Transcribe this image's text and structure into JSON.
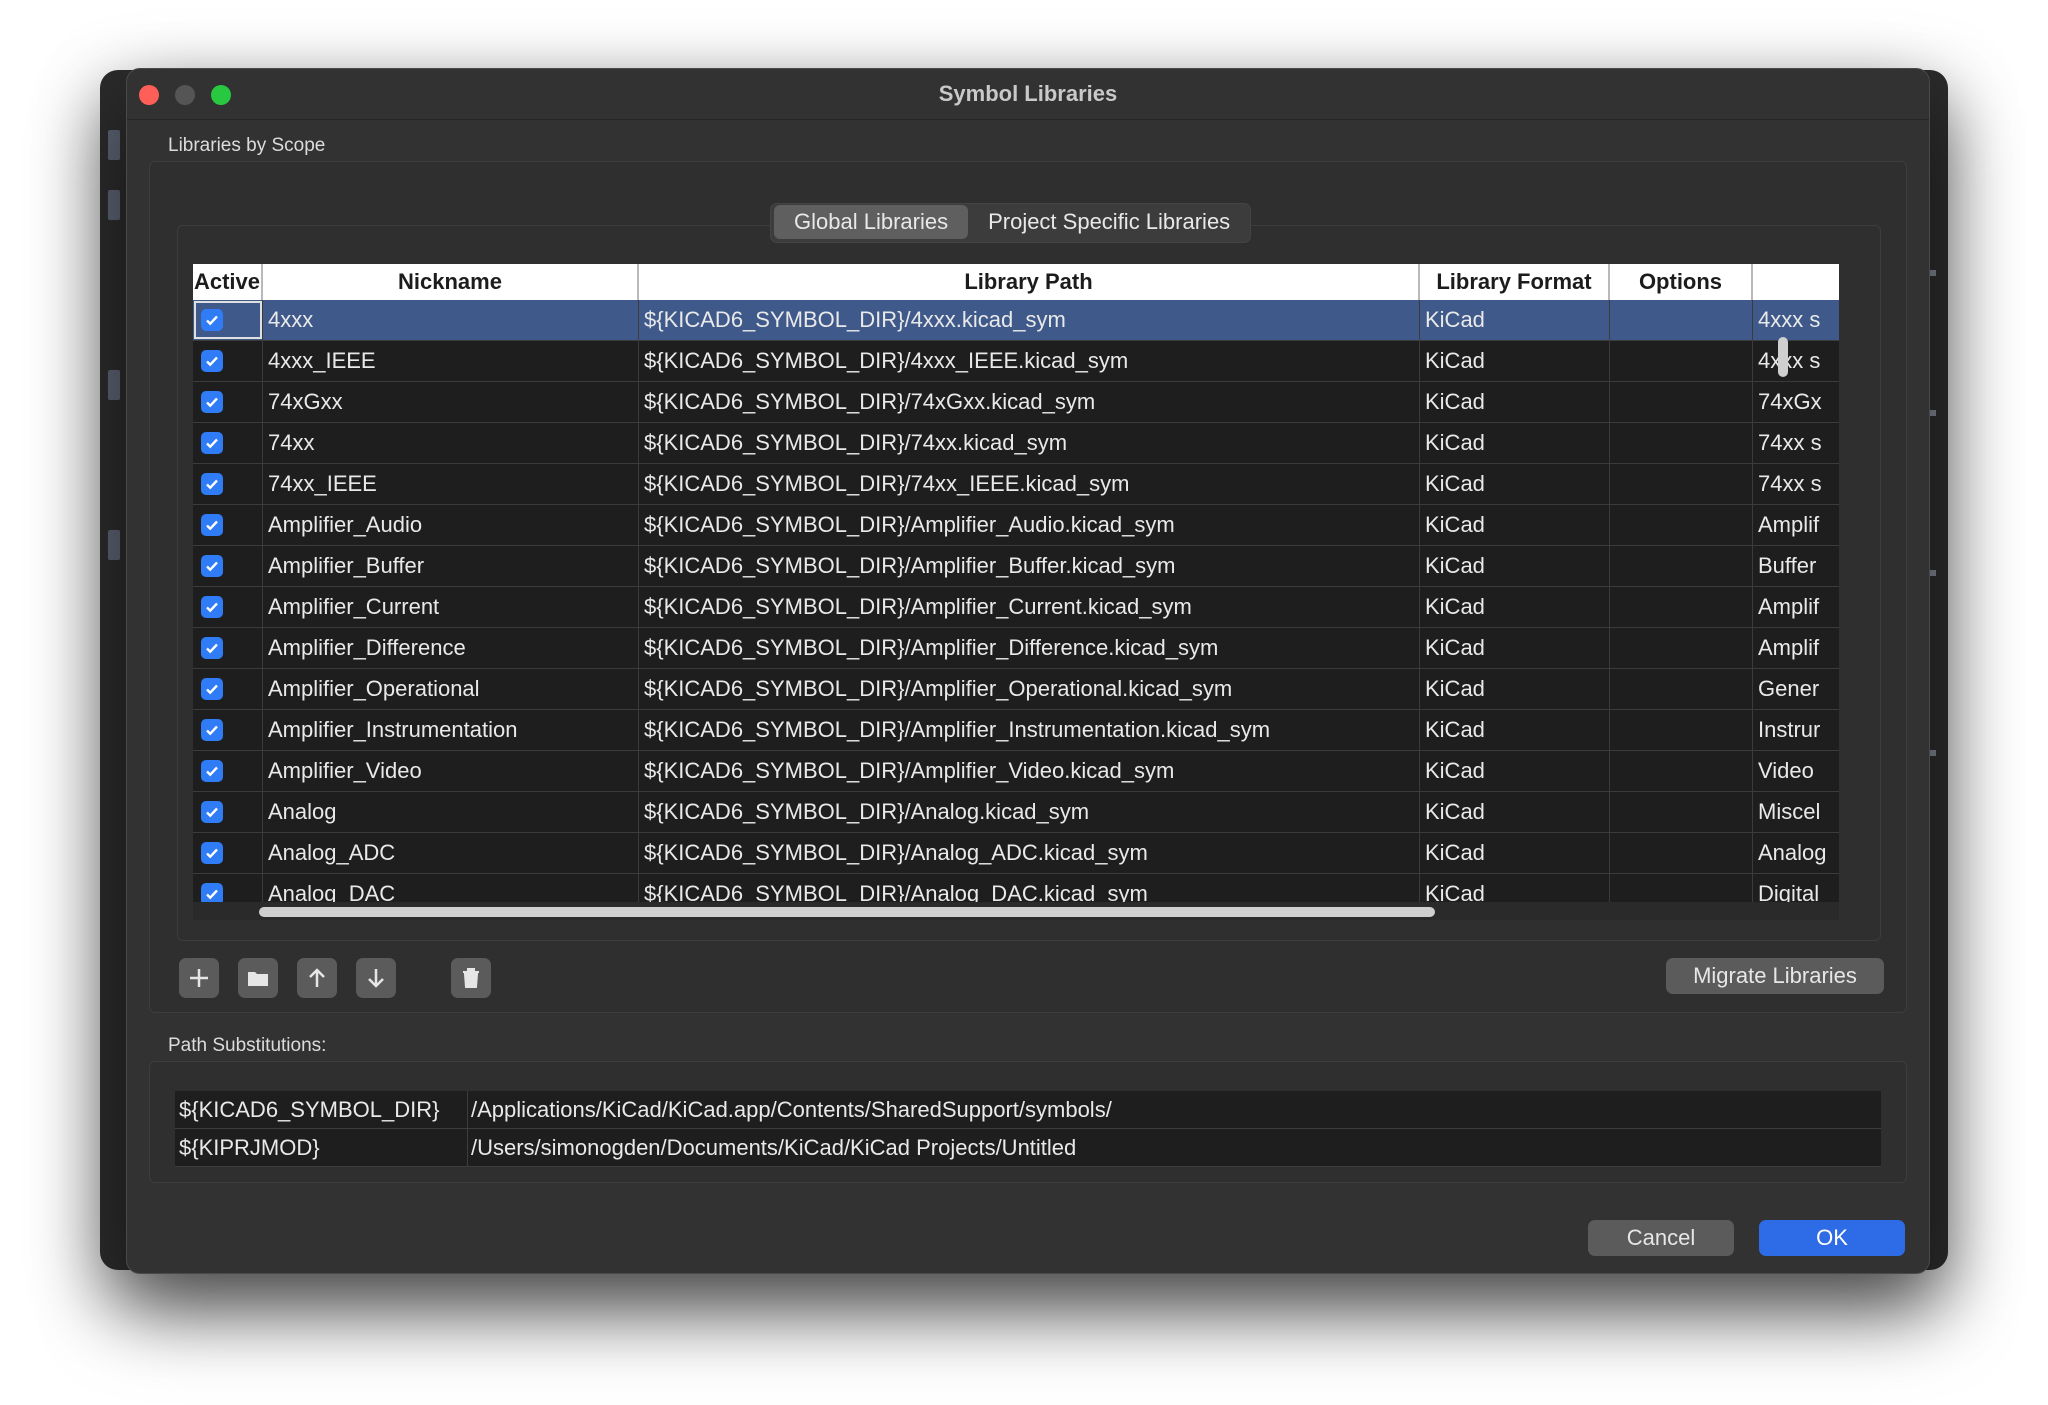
{
  "window": {
    "title": "Symbol Libraries"
  },
  "scope_group": {
    "label": "Libraries by Scope",
    "tabs": [
      {
        "label": "Global Libraries",
        "active": true
      },
      {
        "label": "Project Specific Libraries",
        "active": false
      }
    ]
  },
  "table": {
    "columns": [
      "Active",
      "Nickname",
      "Library Path",
      "Library Format",
      "Options",
      ""
    ],
    "rows": [
      {
        "active": true,
        "nickname": "4xxx",
        "path": "${KICAD6_SYMBOL_DIR}/4xxx.kicad_sym",
        "format": "KiCad",
        "options": "",
        "description": "4xxx s",
        "selected": true
      },
      {
        "active": true,
        "nickname": "4xxx_IEEE",
        "path": "${KICAD6_SYMBOL_DIR}/4xxx_IEEE.kicad_sym",
        "format": "KiCad",
        "options": "",
        "description": "4xxx s"
      },
      {
        "active": true,
        "nickname": "74xGxx",
        "path": "${KICAD6_SYMBOL_DIR}/74xGxx.kicad_sym",
        "format": "KiCad",
        "options": "",
        "description": "74xGx"
      },
      {
        "active": true,
        "nickname": "74xx",
        "path": "${KICAD6_SYMBOL_DIR}/74xx.kicad_sym",
        "format": "KiCad",
        "options": "",
        "description": "74xx s"
      },
      {
        "active": true,
        "nickname": "74xx_IEEE",
        "path": "${KICAD6_SYMBOL_DIR}/74xx_IEEE.kicad_sym",
        "format": "KiCad",
        "options": "",
        "description": "74xx s"
      },
      {
        "active": true,
        "nickname": "Amplifier_Audio",
        "path": "${KICAD6_SYMBOL_DIR}/Amplifier_Audio.kicad_sym",
        "format": "KiCad",
        "options": "",
        "description": "Amplif"
      },
      {
        "active": true,
        "nickname": "Amplifier_Buffer",
        "path": "${KICAD6_SYMBOL_DIR}/Amplifier_Buffer.kicad_sym",
        "format": "KiCad",
        "options": "",
        "description": "Buffer"
      },
      {
        "active": true,
        "nickname": "Amplifier_Current",
        "path": "${KICAD6_SYMBOL_DIR}/Amplifier_Current.kicad_sym",
        "format": "KiCad",
        "options": "",
        "description": "Amplif"
      },
      {
        "active": true,
        "nickname": "Amplifier_Difference",
        "path": "${KICAD6_SYMBOL_DIR}/Amplifier_Difference.kicad_sym",
        "format": "KiCad",
        "options": "",
        "description": "Amplif"
      },
      {
        "active": true,
        "nickname": "Amplifier_Operational",
        "path": "${KICAD6_SYMBOL_DIR}/Amplifier_Operational.kicad_sym",
        "format": "KiCad",
        "options": "",
        "description": "Gener"
      },
      {
        "active": true,
        "nickname": "Amplifier_Instrumentation",
        "path": "${KICAD6_SYMBOL_DIR}/Amplifier_Instrumentation.kicad_sym",
        "format": "KiCad",
        "options": "",
        "description": "Instrur"
      },
      {
        "active": true,
        "nickname": "Amplifier_Video",
        "path": "${KICAD6_SYMBOL_DIR}/Amplifier_Video.kicad_sym",
        "format": "KiCad",
        "options": "",
        "description": "Video"
      },
      {
        "active": true,
        "nickname": "Analog",
        "path": "${KICAD6_SYMBOL_DIR}/Analog.kicad_sym",
        "format": "KiCad",
        "options": "",
        "description": "Miscel"
      },
      {
        "active": true,
        "nickname": "Analog_ADC",
        "path": "${KICAD6_SYMBOL_DIR}/Analog_ADC.kicad_sym",
        "format": "KiCad",
        "options": "",
        "description": "Analog"
      },
      {
        "active": true,
        "nickname": "Analog_DAC",
        "path": "${KICAD6_SYMBOL_DIR}/Analog_DAC.kicad_sym",
        "format": "KiCad",
        "options": "",
        "description": "Digital"
      }
    ]
  },
  "toolbar": {
    "icons": [
      "plus-icon",
      "folder-icon",
      "arrow-up-icon",
      "arrow-down-icon",
      "trash-icon"
    ],
    "migrate_label": "Migrate Libraries"
  },
  "substitutions": {
    "label": "Path Substitutions:",
    "rows": [
      {
        "key": "${KICAD6_SYMBOL_DIR}",
        "value": "/Applications/KiCad/KiCad.app/Contents/SharedSupport/symbols/"
      },
      {
        "key": "${KIPRJMOD}",
        "value": "/Users/simonogden/Documents/KiCad/KiCad Projects/Untitled"
      }
    ]
  },
  "buttons": {
    "cancel": "Cancel",
    "ok": "OK"
  },
  "colors": {
    "accent": "#2e6be6",
    "checkbox": "#2f7cf6",
    "selection": "#3f5a8a"
  }
}
